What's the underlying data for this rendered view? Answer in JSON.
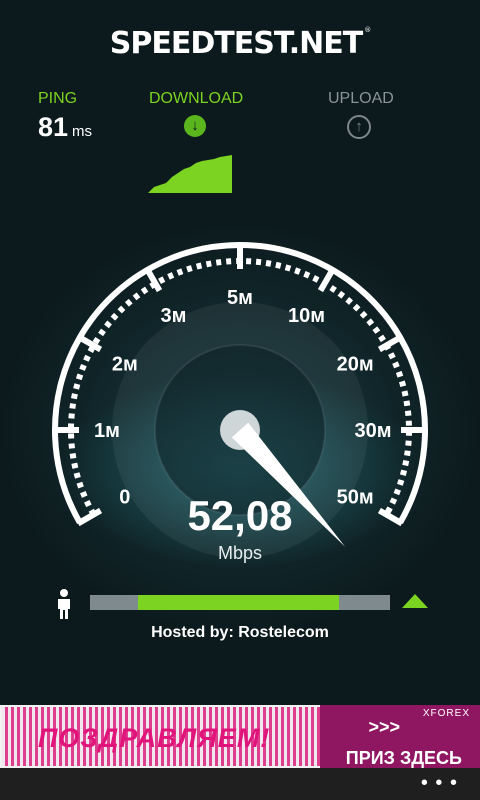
{
  "app": {
    "logo": "SPEEDTEST.NET",
    "logo_mark": "®"
  },
  "ping": {
    "label": "PING",
    "value": "81",
    "unit": "ms"
  },
  "download": {
    "label": "DOWNLOAD",
    "icon": "arrow-down-circle-icon"
  },
  "upload": {
    "label": "UPLOAD",
    "icon": "arrow-up-circle-icon"
  },
  "gauge": {
    "ticks": [
      "0",
      "1м",
      "2м",
      "3м",
      "5м",
      "10м",
      "20м",
      "30м",
      "50м"
    ],
    "current_tick_position": 8.6
  },
  "speed": {
    "value": "52,08",
    "unit": "Mbps"
  },
  "progress": {
    "fraction": 0.83
  },
  "hosted": {
    "text": "Hosted by: Rostelecom"
  },
  "ad": {
    "brand": "XFOREX",
    "headline": "ПОЗДРАВЛЯЕМ!",
    "cta": "ПРИЗ ЗДЕСЬ",
    "arrows": ">>>"
  },
  "appbar": {
    "more": "• • •"
  },
  "colors": {
    "accent_green": "#7cd321",
    "muted": "#8a9396",
    "ad_magenta": "#8f1762"
  }
}
